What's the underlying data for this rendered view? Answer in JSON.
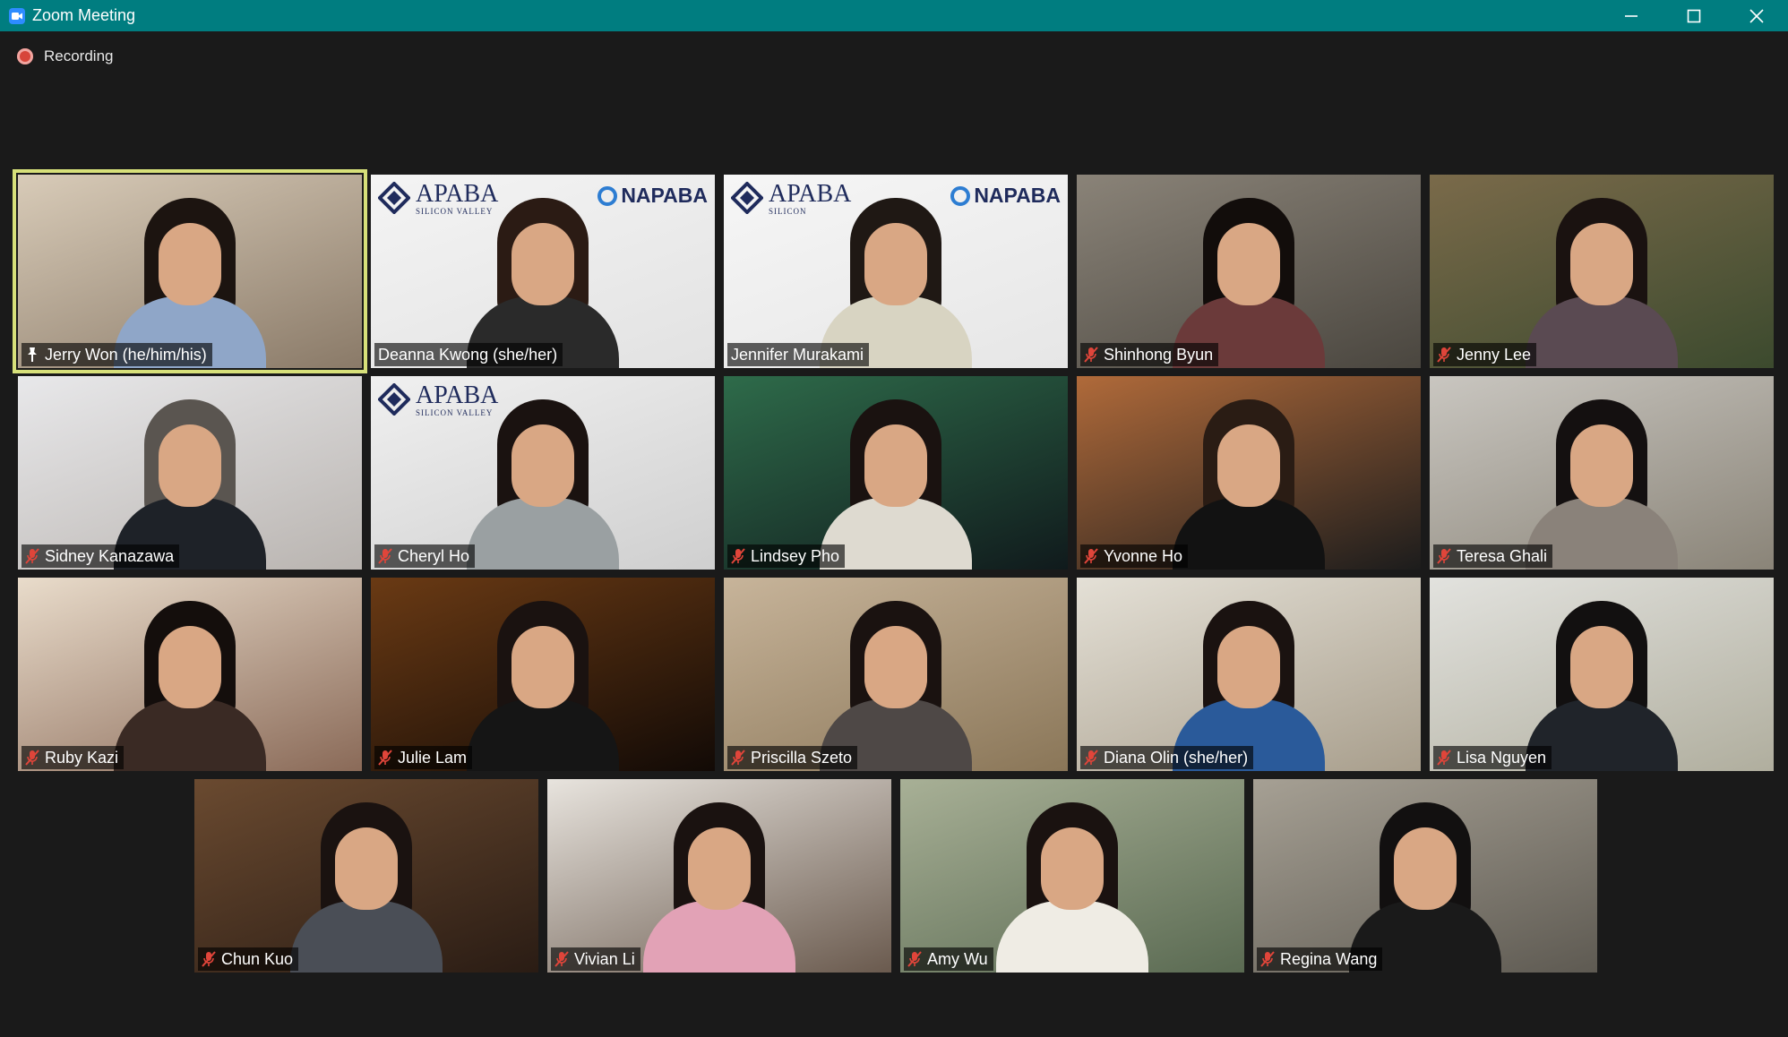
{
  "window": {
    "title": "Zoom Meeting"
  },
  "recording": {
    "label": "Recording"
  },
  "participants": [
    {
      "name": "Jerry Won (he/him/his)",
      "mic": "pinned",
      "active": true,
      "bg": [
        "#d8cbb8",
        "#8a7a68"
      ],
      "shirt": "#8fa6c8",
      "hair": "#1c1410"
    },
    {
      "name": "Deanna Kwong (she/her)",
      "mic": "on",
      "bg": [
        "#f4f4f4",
        "#e2e2e2"
      ],
      "shirt": "#2a2a2a",
      "hair": "#2b1b14",
      "logo": "APABA",
      "logo_sub": "SILICON VALLEY",
      "logo2": "NAPABA"
    },
    {
      "name": "Jennifer Murakami",
      "mic": "on",
      "bg": [
        "#f6f6f6",
        "#e6e6e6"
      ],
      "shirt": "#d8d4c2",
      "hair": "#1f1814",
      "logo": "APABA",
      "logo_sub": "SILICON",
      "logo2": "NAPABA"
    },
    {
      "name": "Shinhong Byun",
      "mic": "muted",
      "bg": [
        "#8a8378",
        "#4a463f"
      ],
      "shirt": "#6b3a3a",
      "hair": "#120d0b"
    },
    {
      "name": "Jenny Lee",
      "mic": "muted",
      "bg": [
        "#7a6a4a",
        "#3c4a2e"
      ],
      "shirt": "#5a4a52",
      "hair": "#1a1210"
    },
    {
      "name": "Sidney Kanazawa",
      "mic": "muted",
      "bg": [
        "#e8e8ea",
        "#b9b4b0"
      ],
      "shirt": "#1e2228",
      "hair": "#5a5550"
    },
    {
      "name": "Cheryl Ho",
      "mic": "muted",
      "bg": [
        "#f0f0f0",
        "#cfcfcf"
      ],
      "shirt": "#9aa0a2",
      "hair": "#1a1210",
      "logo": "APABA",
      "logo_sub": "SILICON VALLEY"
    },
    {
      "name": "Lindsey Pho",
      "mic": "muted",
      "bg": [
        "#2e6b4a",
        "#101a1c"
      ],
      "shirt": "#dedad0",
      "hair": "#1a1210"
    },
    {
      "name": "Yvonne Ho",
      "mic": "muted",
      "bg": [
        "#b06a3a",
        "#1c1c1c"
      ],
      "shirt": "#121212",
      "hair": "#2a1c14"
    },
    {
      "name": "Teresa Ghali",
      "mic": "muted",
      "bg": [
        "#c9c6c0",
        "#8a8478"
      ],
      "shirt": "#8a827a",
      "hair": "#141010"
    },
    {
      "name": "Ruby Kazi",
      "mic": "muted",
      "bg": [
        "#e9dccb",
        "#8a6a58"
      ],
      "shirt": "#3a2a24",
      "hair": "#140e0c"
    },
    {
      "name": "Julie Lam",
      "mic": "muted",
      "bg": [
        "#6a3a14",
        "#120a06"
      ],
      "shirt": "#151515",
      "hair": "#1a1210"
    },
    {
      "name": "Priscilla Szeto",
      "mic": "muted",
      "bg": [
        "#c7b49a",
        "#8a7658"
      ],
      "shirt": "#4e4846",
      "hair": "#1a1210"
    },
    {
      "name": "Diana Olin (she/her)",
      "mic": "muted",
      "bg": [
        "#e4e0d6",
        "#a89e8c"
      ],
      "shirt": "#2a5a9a",
      "hair": "#1a1210"
    },
    {
      "name": "Lisa Nguyen",
      "mic": "muted",
      "bg": [
        "#e2e2de",
        "#b0ae9e"
      ],
      "shirt": "#20242a",
      "hair": "#121010"
    },
    {
      "name": "Chun Kuo",
      "mic": "muted",
      "bg": [
        "#6a4a30",
        "#2a1c14"
      ],
      "shirt": "#4a4e56",
      "hair": "#1a1210"
    },
    {
      "name": "Vivian Li",
      "mic": "muted",
      "bg": [
        "#e8e4de",
        "#6a5a4e"
      ],
      "shirt": "#e2a2b6",
      "hair": "#1a1210"
    },
    {
      "name": "Amy Wu",
      "mic": "muted",
      "bg": [
        "#a8b096",
        "#5a6a52"
      ],
      "shirt": "#efece4",
      "hair": "#1a1210"
    },
    {
      "name": "Regina Wang",
      "mic": "muted",
      "bg": [
        "#a6a094",
        "#5e5a52"
      ],
      "shirt": "#1a1a1a",
      "hair": "#121010"
    }
  ]
}
